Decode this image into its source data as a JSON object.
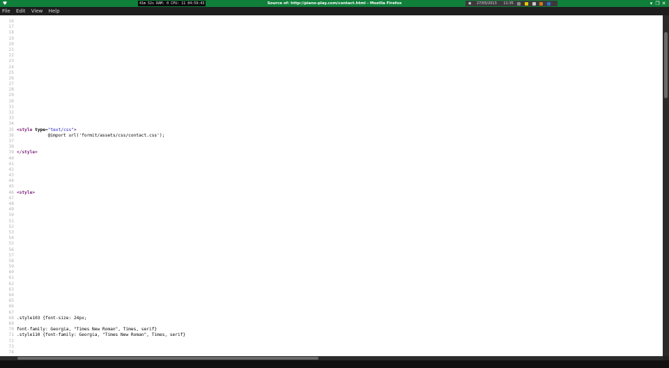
{
  "titlebar": {
    "app_icon": "firefox-icon",
    "sysmon": "41m 52s  RAM: 0  CPU: 11  04:59:43",
    "title": "Source of: http://piano-play.com/contact.html - Mozilla Firefox",
    "tray": {
      "date": "27/05/2013",
      "time": "11:35"
    },
    "buttons": [
      "minimize-icon",
      "restore-icon",
      "close-icon"
    ]
  },
  "menubar": {
    "items": [
      "File",
      "Edit",
      "View",
      "Help"
    ]
  },
  "source": {
    "lines": [
      {
        "n": "16",
        "html": ""
      },
      {
        "n": "17",
        "html": ""
      },
      {
        "n": "18",
        "html": ""
      },
      {
        "n": "19",
        "html": ""
      },
      {
        "n": "20",
        "html": ""
      },
      {
        "n": "21",
        "html": ""
      },
      {
        "n": "22",
        "html": ""
      },
      {
        "n": "23",
        "html": ""
      },
      {
        "n": "24",
        "html": ""
      },
      {
        "n": "25",
        "html": ""
      },
      {
        "n": "26",
        "html": ""
      },
      {
        "n": "27",
        "html": ""
      },
      {
        "n": "28",
        "html": ""
      },
      {
        "n": "29",
        "html": ""
      },
      {
        "n": "30",
        "html": ""
      },
      {
        "n": "31",
        "html": ""
      },
      {
        "n": "32",
        "html": ""
      },
      {
        "n": "33",
        "html": ""
      },
      {
        "n": "34",
        "html": ""
      },
      {
        "n": "35",
        "html": "<span class=\"tag\">&lt;style</span> <span class=\"attr\">type</span>=<span class=\"val\">\"text/css\"</span><span class=\"tag\">&gt;</span>"
      },
      {
        "n": "36",
        "html": "            @import url('formit/assets/css/contact.css');"
      },
      {
        "n": "37",
        "html": ""
      },
      {
        "n": "38",
        "html": ""
      },
      {
        "n": "39",
        "html": "<span class=\"tag\">&lt;/style&gt;</span>"
      },
      {
        "n": "40",
        "html": ""
      },
      {
        "n": "41",
        "html": ""
      },
      {
        "n": "42",
        "html": ""
      },
      {
        "n": "43",
        "html": ""
      },
      {
        "n": "44",
        "html": ""
      },
      {
        "n": "45",
        "html": ""
      },
      {
        "n": "46",
        "html": "<span class=\"tag\">&lt;style&gt;</span>"
      },
      {
        "n": "47",
        "html": ""
      },
      {
        "n": "48",
        "html": ""
      },
      {
        "n": "49",
        "html": ""
      },
      {
        "n": "50",
        "html": ""
      },
      {
        "n": "51",
        "html": ""
      },
      {
        "n": "52",
        "html": ""
      },
      {
        "n": "53",
        "html": ""
      },
      {
        "n": "54",
        "html": ""
      },
      {
        "n": "55",
        "html": ""
      },
      {
        "n": "56",
        "html": ""
      },
      {
        "n": "57",
        "html": ""
      },
      {
        "n": "58",
        "html": ""
      },
      {
        "n": "59",
        "html": ""
      },
      {
        "n": "60",
        "html": ""
      },
      {
        "n": "61",
        "html": ""
      },
      {
        "n": "62",
        "html": ""
      },
      {
        "n": "63",
        "html": ""
      },
      {
        "n": "64",
        "html": ""
      },
      {
        "n": "65",
        "html": ""
      },
      {
        "n": "66",
        "html": ""
      },
      {
        "n": "67",
        "html": ""
      },
      {
        "n": "68",
        "html": ".style103 {font-size: 24px;"
      },
      {
        "n": "69",
        "html": ""
      },
      {
        "n": "70",
        "html": "font-family: Georgia, \"Times New Roman\", Times, serif}"
      },
      {
        "n": "71",
        "html": ".style110 {font-family: Georgia, \"Times New Roman\", Times, serif}"
      },
      {
        "n": "72",
        "html": ""
      },
      {
        "n": "73",
        "html": ""
      },
      {
        "n": "74",
        "html": ""
      }
    ]
  },
  "colors": {
    "titlebar_bg": "#0f7f3a",
    "tag_color": "#7a1f7a",
    "attr_value_color": "#1d1dbf",
    "line_number_color": "#b3b3b3"
  }
}
